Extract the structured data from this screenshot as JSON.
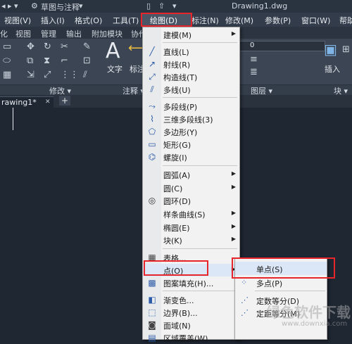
{
  "titlebar": {
    "workspace": "草图与注释",
    "filename": "Drawing1.dwg"
  },
  "menubar": {
    "items": [
      "视图(V)",
      "插入(I)",
      "格式(O)",
      "工具(T)",
      "绘图(D)",
      "标注(N)",
      "修改(M)",
      "参数(P)",
      "窗口(W)",
      "帮助"
    ]
  },
  "ribbon_tabs": [
    "化",
    "视图",
    "管理",
    "输出",
    "附加模块",
    "协作"
  ],
  "ribbon": {
    "text_label": "文字",
    "dim_label": "标注",
    "insert_label": "插入",
    "layer_value": "0",
    "panels": [
      "修改 ▾",
      "注释 ▾",
      "图层 ▾",
      "块 ▾"
    ]
  },
  "doc_tab": {
    "label": "rawing1*",
    "close": "✕",
    "add": "+"
  },
  "draw_menu": {
    "items": [
      {
        "label": "建模(M)",
        "sub": true
      },
      {
        "label": "直线(L)",
        "icon": "line"
      },
      {
        "label": "射线(R)",
        "icon": "ray"
      },
      {
        "label": "构造线(T)",
        "icon": "xline"
      },
      {
        "label": "多线(U)",
        "icon": "mline"
      },
      {
        "label": "多段线(P)",
        "icon": "pline"
      },
      {
        "label": "三维多段线(3)",
        "icon": "3dpoly"
      },
      {
        "label": "多边形(Y)",
        "icon": "polygon"
      },
      {
        "label": "矩形(G)",
        "icon": "rect"
      },
      {
        "label": "螺旋(I)",
        "icon": "helix"
      },
      {
        "label": "圆弧(A)",
        "sub": true
      },
      {
        "label": "圆(C)",
        "sub": true
      },
      {
        "label": "圆环(D)",
        "icon": "donut"
      },
      {
        "label": "样条曲线(S)",
        "sub": true
      },
      {
        "label": "椭圆(E)",
        "sub": true
      },
      {
        "label": "块(K)",
        "sub": true
      },
      {
        "label": "表格...",
        "icon": "table"
      },
      {
        "label": "点(O)",
        "sub": true
      },
      {
        "label": "图案填充(H)...",
        "icon": "hatch"
      },
      {
        "label": "渐变色...",
        "icon": "gradient"
      },
      {
        "label": "边界(B)...",
        "icon": "boundary"
      },
      {
        "label": "面域(N)",
        "icon": "region"
      },
      {
        "label": "区域覆盖(W)",
        "icon": "wipeout"
      }
    ]
  },
  "point_submenu": {
    "items": [
      "单点(S)",
      "多点(P)",
      "定数等分(D)",
      "定距等分(M)"
    ]
  },
  "watermark": {
    "text": "绿色软件下载",
    "url": "www.downxia.com"
  }
}
